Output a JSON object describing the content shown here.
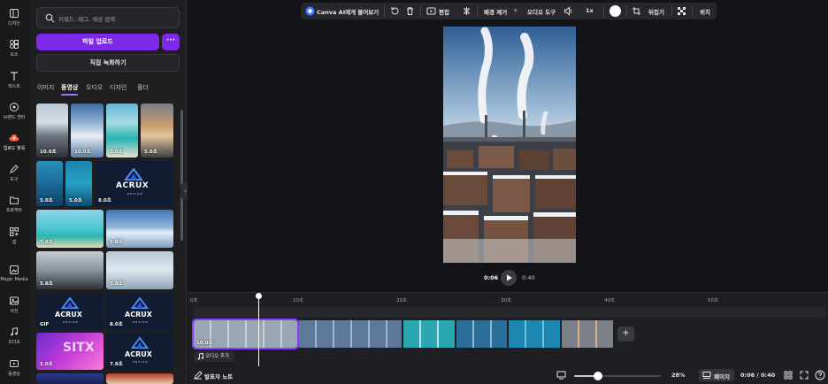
{
  "rail": {
    "items": [
      {
        "label": "디자인",
        "icon": "layout-icon"
      },
      {
        "label": "요소",
        "icon": "shapes-icon"
      },
      {
        "label": "텍스트",
        "icon": "text-icon"
      },
      {
        "label": "브랜드 센터",
        "icon": "brand-icon"
      },
      {
        "label": "업로드 항목",
        "icon": "upload-cloud-icon"
      },
      {
        "label": "도구",
        "icon": "pen-icon"
      },
      {
        "label": "프로젝트",
        "icon": "folder-icon"
      },
      {
        "label": "앱",
        "icon": "apps-icon"
      },
      {
        "label": "Magic Media",
        "icon": "magic-media-icon"
      },
      {
        "label": "사진",
        "icon": "photo-icon"
      },
      {
        "label": "오디오",
        "icon": "music-icon"
      },
      {
        "label": "동영상",
        "icon": "video-icon"
      }
    ]
  },
  "panel": {
    "search_placeholder": "키워드, 태그, 색상 검색",
    "upload_label": "파일 업로드",
    "more_label": "···",
    "record_label": "직접 녹화하기",
    "tabs": [
      "이미지",
      "동영상",
      "오디오",
      "디자인",
      "폴더"
    ],
    "thumbs": [
      {
        "label": "10.0초"
      },
      {
        "label": "10.0초"
      },
      {
        "label": "5.0초"
      },
      {
        "label": "5.0초"
      },
      {
        "label": "5.0초"
      },
      {
        "label": "5.0초"
      },
      {
        "label": "8.0초",
        "logo": "ACRUX",
        "sub": "DESIGN"
      },
      {
        "label": "5.8초"
      },
      {
        "label": "5.8초"
      },
      {
        "label": "5.8초"
      },
      {
        "label": "5.8초"
      },
      {
        "label": "GIF",
        "logo": "ACRUX",
        "sub": "DESIGN"
      },
      {
        "label": "8.0초",
        "logo": "ACRUX",
        "sub": "DESIGN"
      },
      {
        "label": "5.0초",
        "overlay": "SITX"
      },
      {
        "label": "7.9초",
        "logo": "ACRUX",
        "sub": "DESIGN"
      }
    ]
  },
  "toolbar": {
    "ai_label": "Canva AI에게 물어보기",
    "edit_label": "편집",
    "bg_remove_label": "배경 제거",
    "audio_tools_label": "오디오 도구",
    "speed_label": "1x",
    "flip_label": "뒤집기",
    "position_label": "위치"
  },
  "player": {
    "current": "0:06",
    "total": "0:40"
  },
  "timeline": {
    "ticks": [
      "0초",
      "10초",
      "20초",
      "30초",
      "40초",
      "50초"
    ],
    "clip_label": "10.0초",
    "add_audio_label": "오디오 추가"
  },
  "footer": {
    "notes_label": "발표자 노트",
    "zoom": "28%",
    "zoom_fraction": 0.28,
    "page_label": "페이지",
    "time": "0:06 / 0:40"
  }
}
